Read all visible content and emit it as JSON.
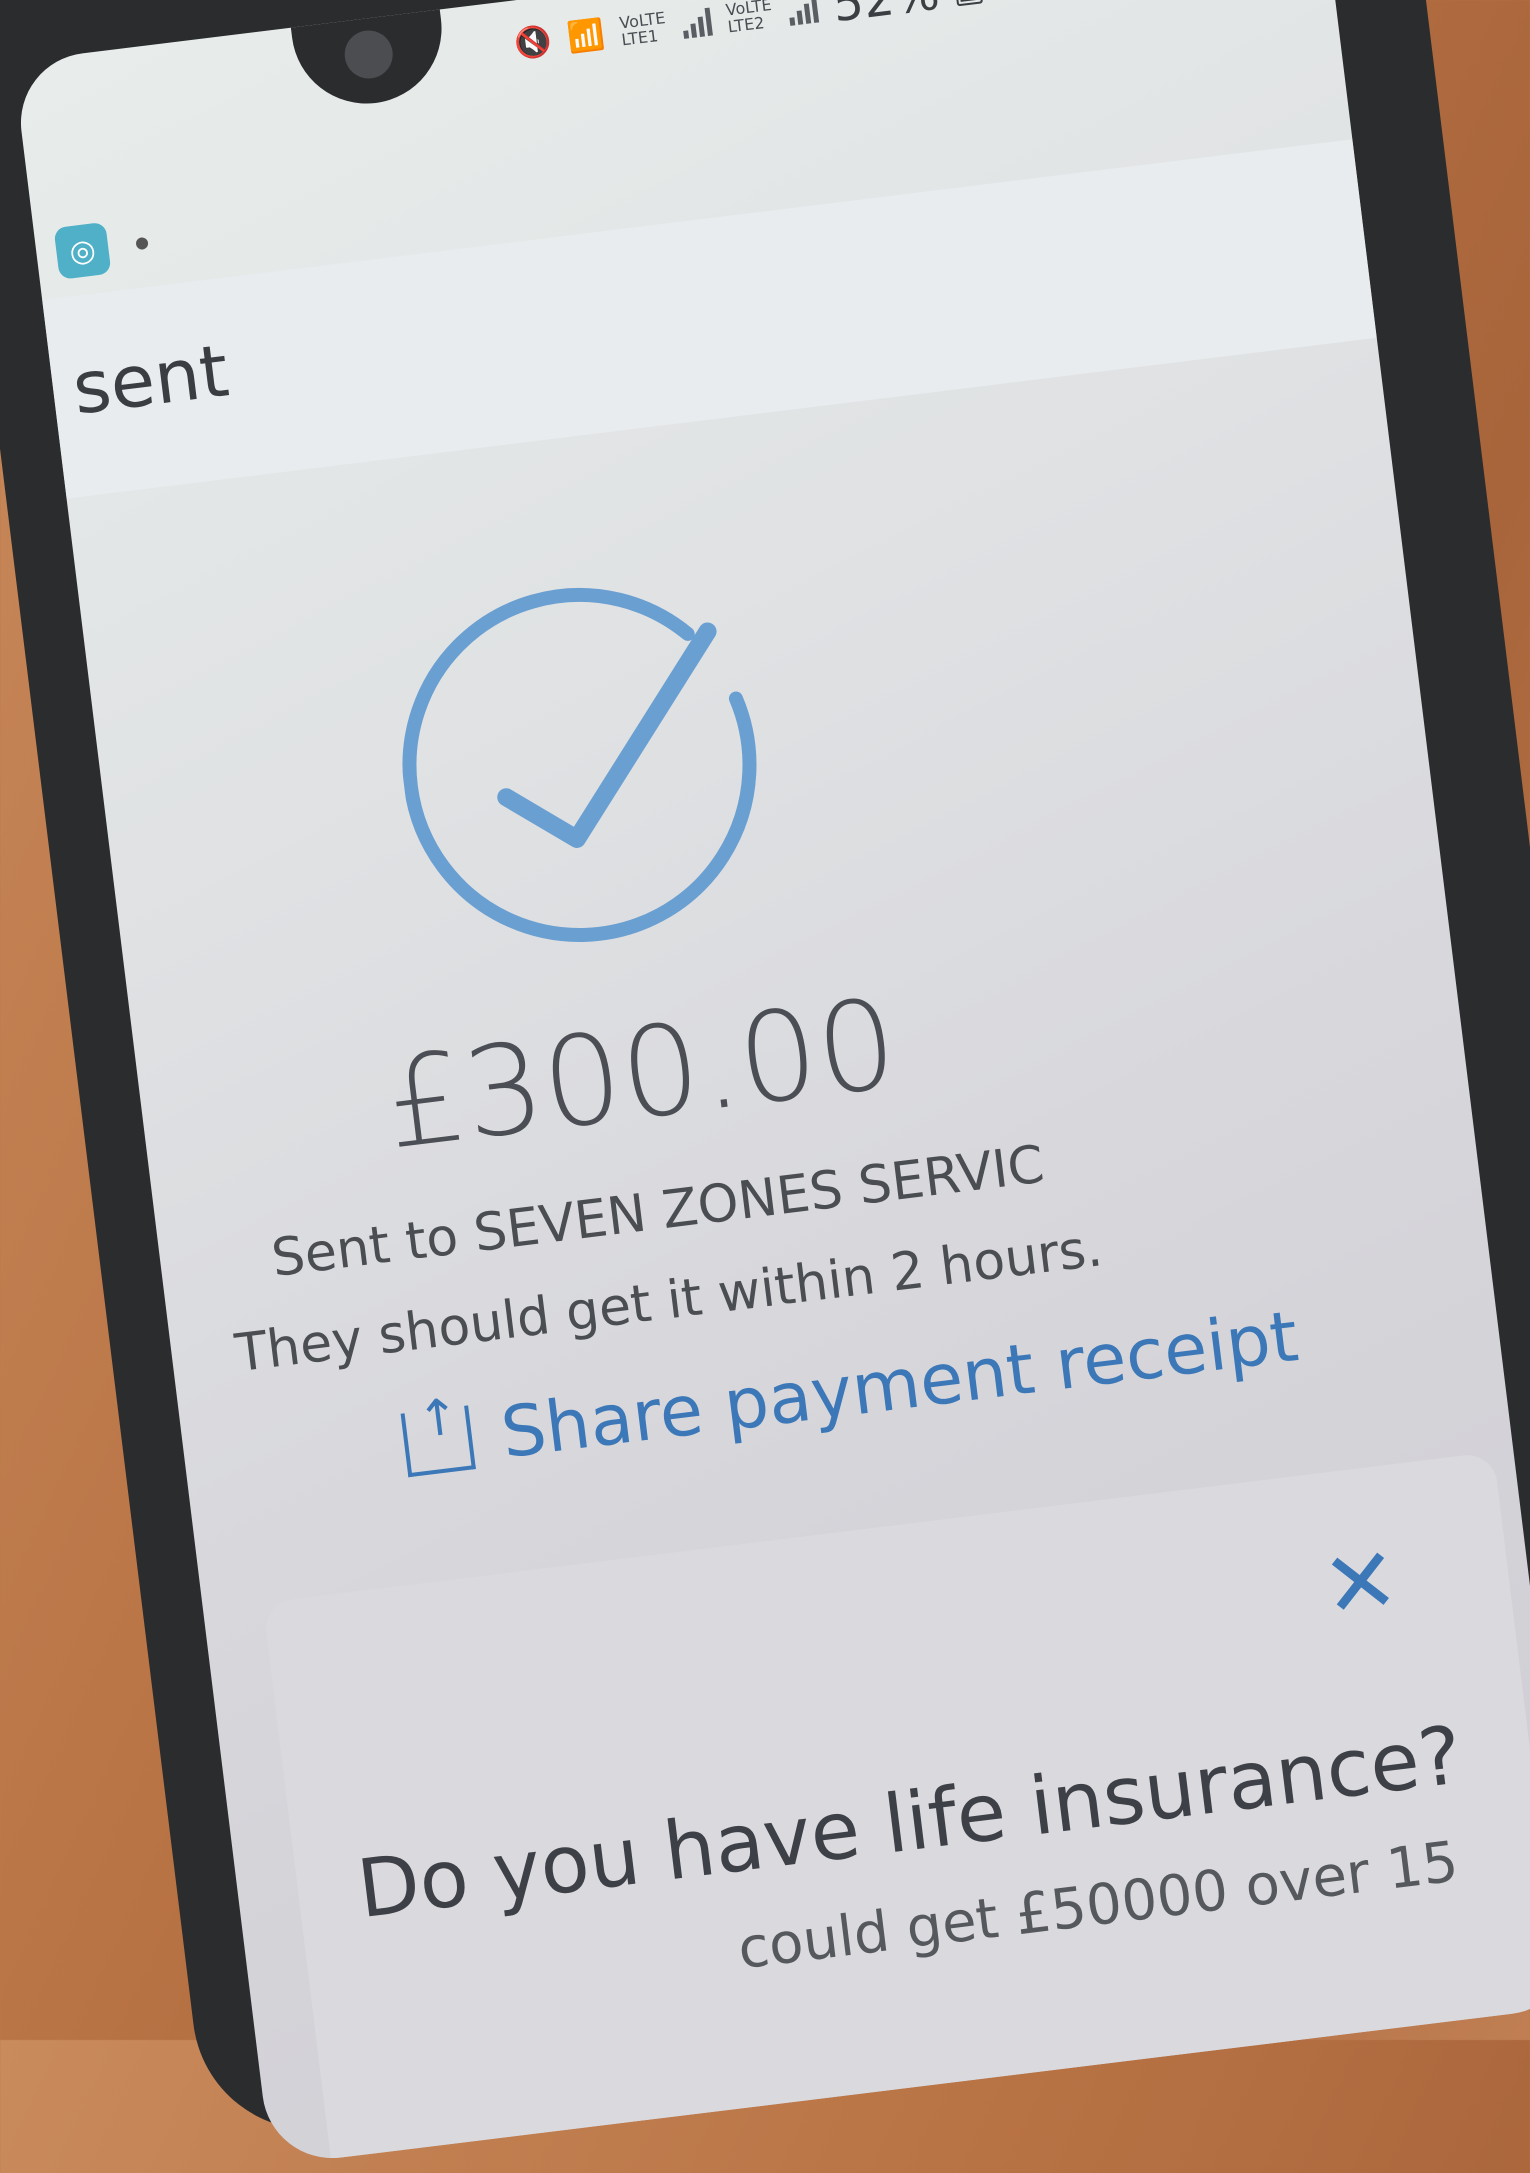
{
  "status_bar": {
    "network1_top": "VoLTE",
    "network1_bottom": "LTE1",
    "network2_top": "VoLTE",
    "network2_bottom": "LTE2",
    "battery": "52%"
  },
  "header": {
    "title": "sent"
  },
  "confirmation": {
    "amount": "£300.00",
    "recipient_line": "Sent to SEVEN ZONES SERVIC",
    "eta_line": "They should get it within 2 hours.",
    "share_label": "Share payment receipt"
  },
  "promo": {
    "title": "Do you have life insurance?",
    "subtitle": "could get £50000 over 15"
  },
  "colors": {
    "accent": "#3c78b8",
    "check": "#6a9fd2"
  }
}
